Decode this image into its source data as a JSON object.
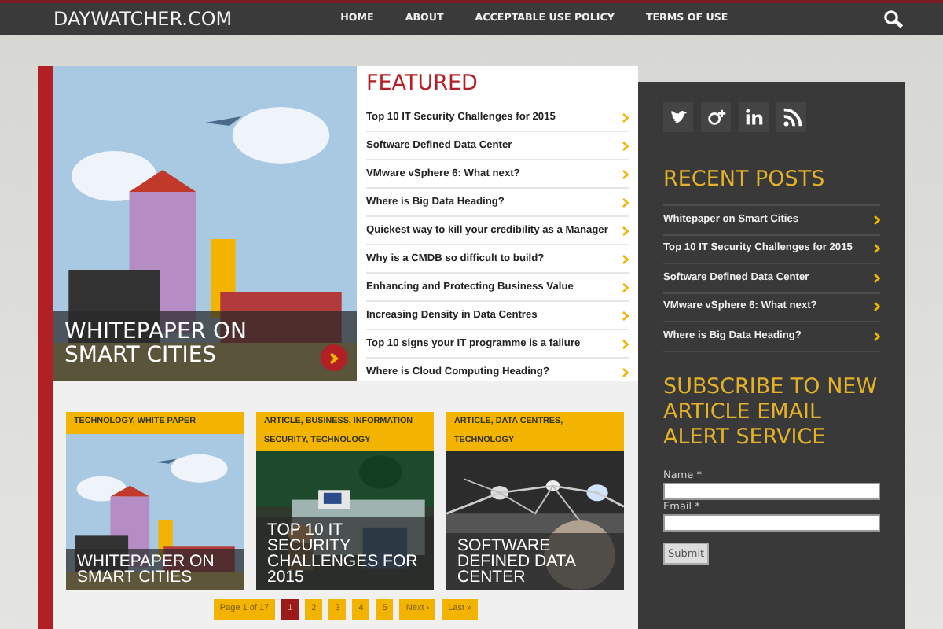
{
  "site": {
    "logo": "DAYWATCHER.COM"
  },
  "nav": [
    {
      "label": "HOME"
    },
    {
      "label": "ABOUT"
    },
    {
      "label": "ACCEPTABLE USE POLICY"
    },
    {
      "label": "TERMS OF USE"
    }
  ],
  "hero": {
    "title": "WHITEPAPER ON SMART CITIES"
  },
  "featured": {
    "heading": "FEATURED",
    "items": [
      {
        "title": "Top 10 IT Security Challenges for 2015"
      },
      {
        "title": "Software Defined Data Center"
      },
      {
        "title": "VMware vSphere 6: What next?"
      },
      {
        "title": "Where is Big Data Heading?"
      },
      {
        "title": "Quickest way to kill your credibility as a Manager"
      },
      {
        "title": "Why is a CMDB so difficult to build?"
      },
      {
        "title": "Enhancing and Protecting Business Value"
      },
      {
        "title": "Increasing Density in Data Centres"
      },
      {
        "title": "Top 10 signs your IT programme is a failure"
      },
      {
        "title": "Where is Cloud Computing Heading?"
      }
    ]
  },
  "cards": [
    {
      "tags": "TECHNOLOGY, WHITE PAPER",
      "title": "WHITEPAPER ON SMART CITIES"
    },
    {
      "tags": "ARTICLE, BUSINESS, INFORMATION SECURITY, TECHNOLOGY",
      "title": "TOP 10 IT SECURITY CHALLENGES FOR 2015"
    },
    {
      "tags": "ARTICLE, DATA CENTRES, TECHNOLOGY",
      "title": "SOFTWARE DEFINED DATA CENTER"
    }
  ],
  "pagination": [
    {
      "label": "Page 1 of 17",
      "kind": "info"
    },
    {
      "label": "1",
      "kind": "page",
      "selected": true
    },
    {
      "label": "2",
      "kind": "page",
      "selected": false
    },
    {
      "label": "3",
      "kind": "page",
      "selected": false
    },
    {
      "label": "4",
      "kind": "page",
      "selected": false
    },
    {
      "label": "5",
      "kind": "page",
      "selected": false
    },
    {
      "label": "Next ›",
      "kind": "page",
      "selected": false
    },
    {
      "label": "Last »",
      "kind": "page",
      "selected": false
    }
  ],
  "sidebar": {
    "recent_heading": "RECENT POSTS",
    "recent": [
      {
        "title": "Whitepaper on Smart Cities"
      },
      {
        "title": "Top 10 IT Security Challenges for 2015"
      },
      {
        "title": "Software Defined Data Center"
      },
      {
        "title": "VMware vSphere 6: What next?"
      },
      {
        "title": "Where is Big Data Heading?"
      }
    ],
    "subscribe_heading": "SUBSCRIBE TO NEW ARTICLE EMAIL ALERT SERVICE",
    "fields": [
      {
        "label": "Name *"
      },
      {
        "label": "Email *"
      }
    ],
    "submit": "Submit"
  }
}
